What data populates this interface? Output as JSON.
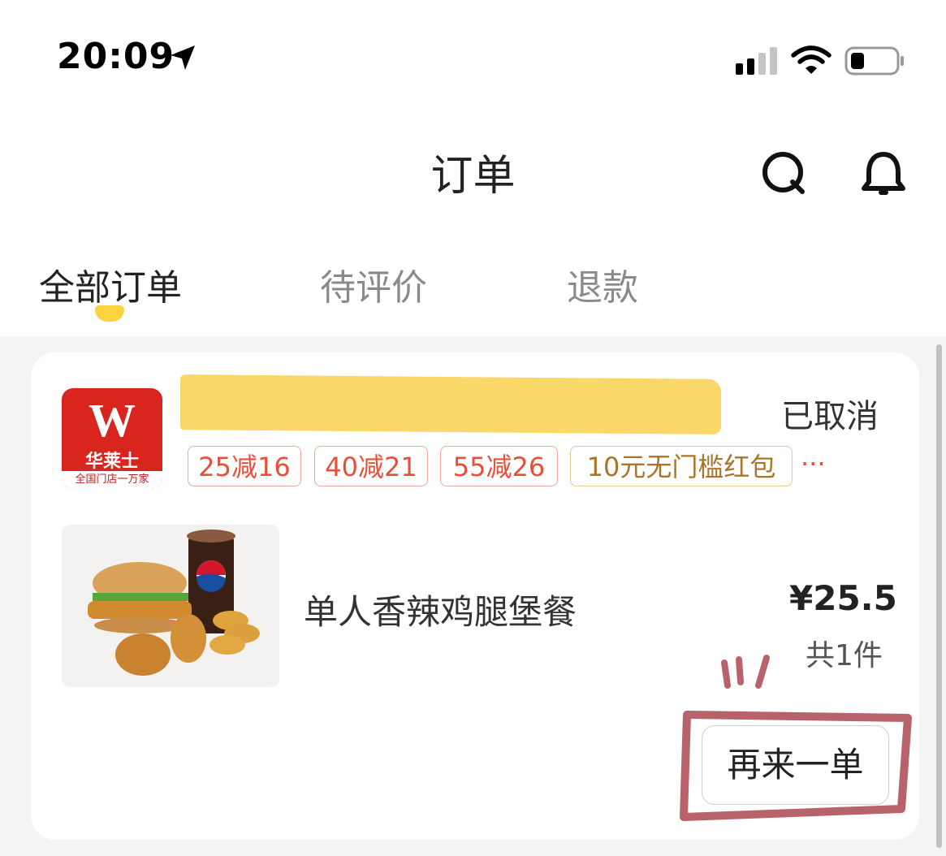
{
  "status_bar": {
    "time": "20:09"
  },
  "header": {
    "title": "订单"
  },
  "tabs": [
    {
      "label": "全部订单",
      "active": true
    },
    {
      "label": "待评价",
      "active": false
    },
    {
      "label": "退款",
      "active": false
    }
  ],
  "order": {
    "shop_logo": {
      "letter": "W",
      "brand": "华莱士",
      "slogan": "全国门店一万家"
    },
    "status": "已取消",
    "promotions": [
      "25减16",
      "40减21",
      "55减26",
      "10元无门槛红包"
    ],
    "more_promotions": "···",
    "item": {
      "name": "单人香辣鸡腿堡餐",
      "price": "¥25.5",
      "quantity": "共1件"
    },
    "reorder_label": "再来一单"
  },
  "colors": {
    "accent_yellow": "#fcd33f",
    "highlight_yellow": "#fad769",
    "promo_red": "#e84f3b",
    "promo_gold": "#a8752a",
    "annotation_red": "#b8636a",
    "brand_red": "#d8261f"
  }
}
